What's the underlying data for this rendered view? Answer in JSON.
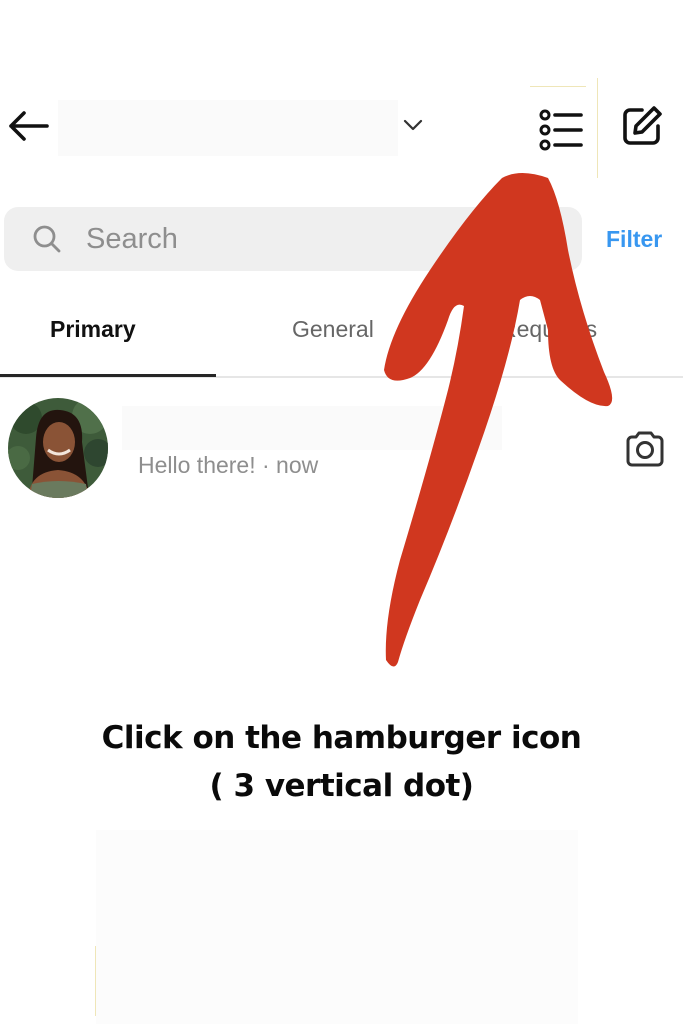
{
  "header": {
    "back_icon": "arrow-left-icon",
    "dropdown_icon": "chevron-down-icon",
    "list_icon": "list-icon",
    "compose_icon": "compose-icon"
  },
  "search": {
    "placeholder": "Search",
    "icon": "search-icon"
  },
  "filter_label": "Filter",
  "tabs": [
    {
      "label": "Primary",
      "active": true
    },
    {
      "label": "General",
      "active": false
    },
    {
      "label": "Requests",
      "active": false
    }
  ],
  "conversation": {
    "preview": "Hello there! · now",
    "camera_icon": "camera-icon"
  },
  "annotation": {
    "color": "#d0371f",
    "caption_line1": "Click on the hamburger icon",
    "caption_line2": "( 3 vertical dot)"
  },
  "colors": {
    "accent": "#3897f0",
    "search_bg": "#efefef",
    "muted_text": "#8e8e8e"
  }
}
